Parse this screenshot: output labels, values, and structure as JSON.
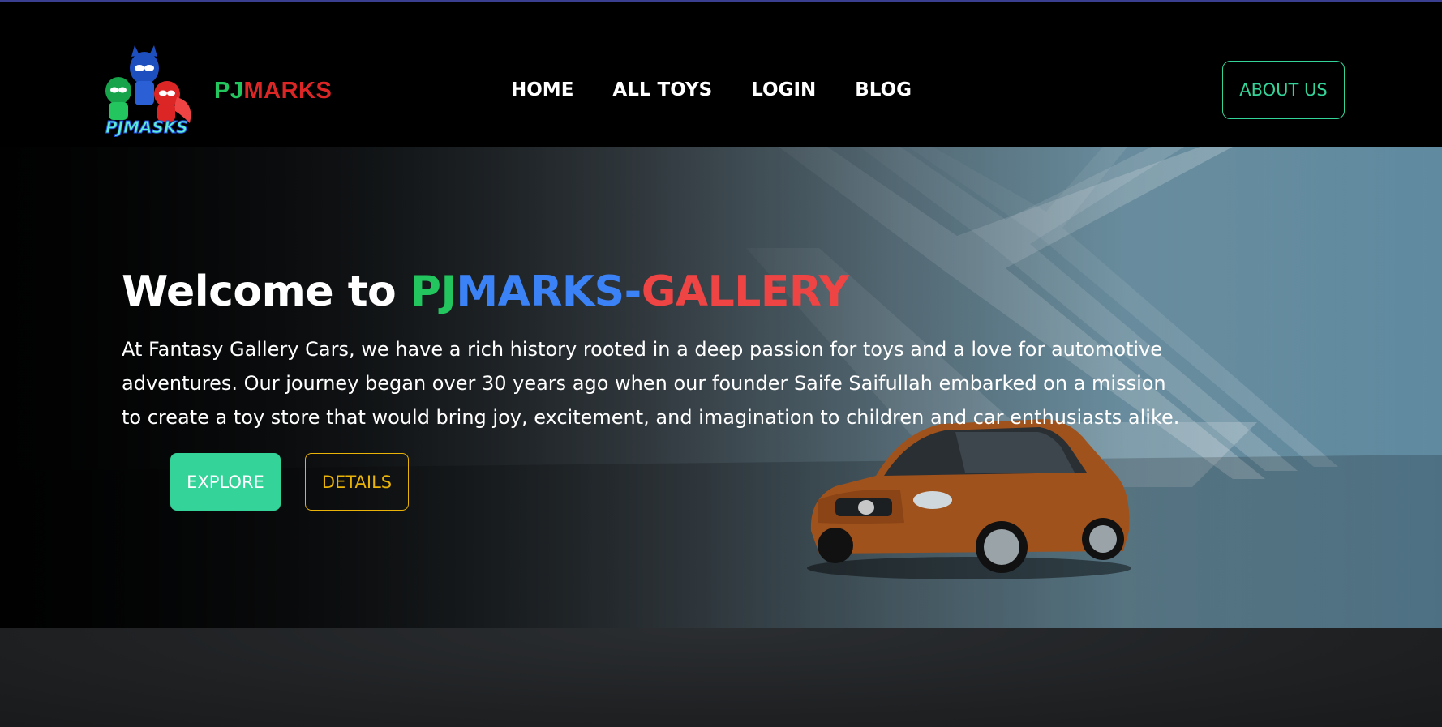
{
  "brand": {
    "prefix": "PJ",
    "suffix": "MARKS",
    "logo_icon": "pj-masks-logo"
  },
  "nav": {
    "links": [
      {
        "label": "HOME"
      },
      {
        "label": "ALL TOYS"
      },
      {
        "label": "LOGIN"
      },
      {
        "label": "BLOG"
      }
    ],
    "about_label": "ABOUT US"
  },
  "hero": {
    "title_prefix": "Welcome to ",
    "title_pj": "PJ",
    "title_marks": "MARKS-",
    "title_gallery": "GALLERY",
    "description": "At Fantasy Gallery Cars, we have a rich history rooted in a deep passion for toys and a love for automotive adventures. Our journey began over 30 years ago when our founder Saife Saifullah embarked on a mission to create a toy store that would bring joy, excitement, and imagination to children and car enthusiasts alike.",
    "explore_label": "EXPLORE",
    "details_label": "DETAILS",
    "image_icon": "orange-car-image"
  },
  "colors": {
    "accent_green": "#34d399",
    "brand_green": "#22c55e",
    "brand_red": "#dc2626",
    "brand_blue": "#3b82f6",
    "details_yellow": "#eab308"
  }
}
